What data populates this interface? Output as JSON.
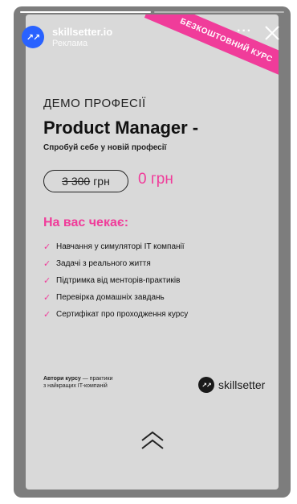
{
  "account": {
    "avatar_glyph": "↗↗",
    "name": "skillsetter.io",
    "sponsored": "Реклама",
    "more": "···"
  },
  "ad": {
    "ribbon": "БЕЗКОШТОВНИЙ КУРС",
    "section_label": "ДЕМО ПРОФЕСІЇ",
    "title": "Product Manager -",
    "subtitle": "Спробуй себе у новій професії",
    "old_price": "3 300",
    "currency": "грн",
    "new_price": "0 грн",
    "awaits_heading": "На вас чекає:",
    "benefits": [
      "Навчання у симуляторі IT компанії",
      "Задачі з реального життя",
      "Підтримка від менторів-практиків",
      "Перевірка домашніх завдань",
      "Сертифікат про проходження курсу"
    ],
    "authors_bold": "Автори курсу",
    "authors_rest_1": " — практики",
    "authors_rest_2": "з найкращих IT-компаній",
    "brand_logo_glyph": "↗↗",
    "brand_name": "skillsetter"
  },
  "colors": {
    "accent": "#f03c9a",
    "avatar_blue": "#2962ff",
    "card_bg": "#d9d9d9"
  },
  "icons": {
    "close": "close-icon",
    "check": "check-icon",
    "swipe_up": "chevron-double-up-icon"
  }
}
